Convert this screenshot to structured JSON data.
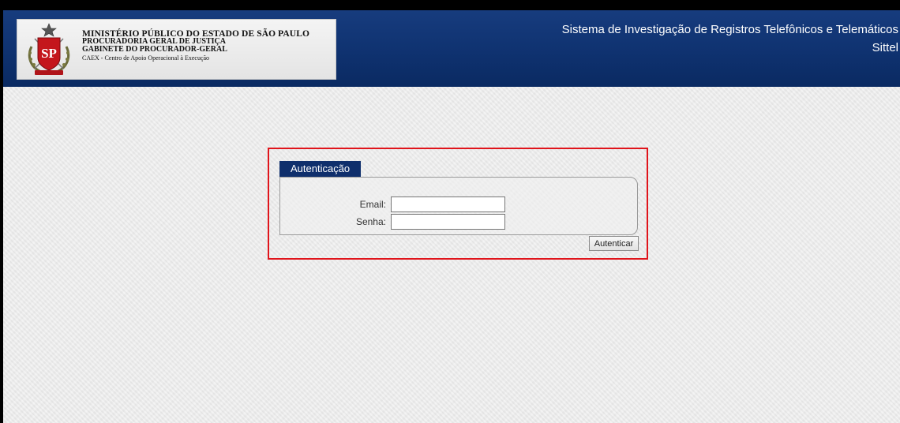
{
  "header": {
    "org": {
      "line1": "MINISTÉRIO PÚBLICO DO ESTADO DE SÃO PAULO",
      "line2": "PROCURADORIA GERAL DE JUSTIÇA",
      "line3": "GABINETE DO PROCURADOR-GERAL",
      "line4": "CAEX - Centro de Apoio Operacional à Execução"
    },
    "system_title": "Sistema de Investigação de Registros Telefônicos e Telemáticos",
    "system_short": "Sittel",
    "seal_text": "SP",
    "colors": {
      "header_bg": "#0f3270",
      "seal_red": "#c4161c"
    }
  },
  "auth": {
    "tab_label": "Autenticação",
    "email_label": "Email:",
    "email_value": "",
    "password_label": "Senha:",
    "password_value": "",
    "submit_label": "Autenticar",
    "highlight_color": "#e0141b"
  }
}
